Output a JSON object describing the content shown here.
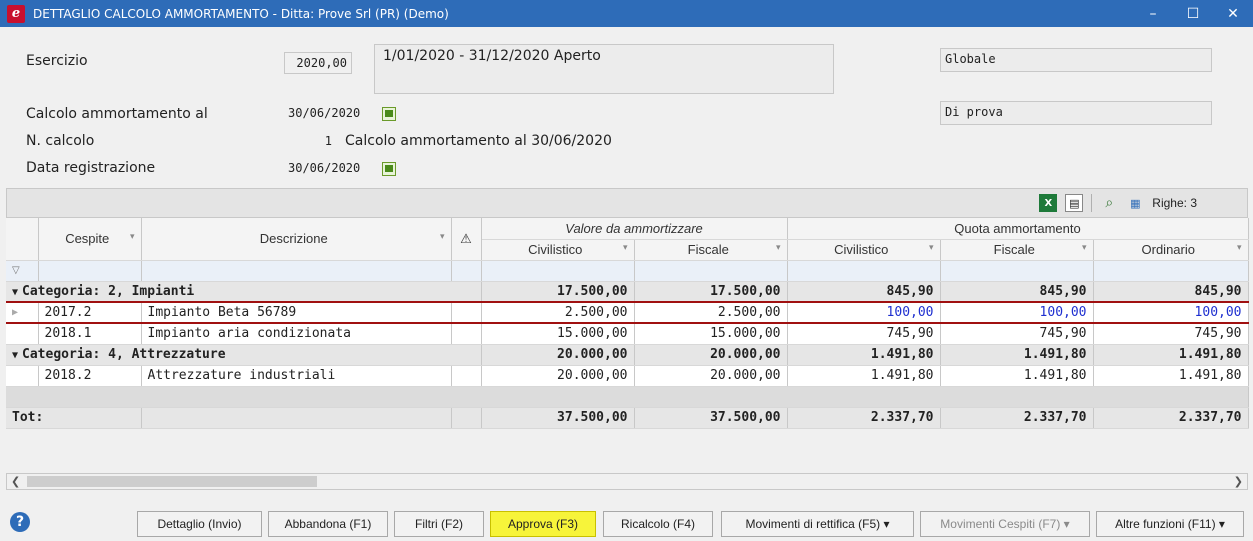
{
  "window": {
    "title": "DETTAGLIO CALCOLO AMMORTAMENTO - Ditta: Prove Srl (PR) (Demo)",
    "minimize": "–",
    "maximize": "☐",
    "close": "✕"
  },
  "header": {
    "esercizio_label": "Esercizio",
    "esercizio_value": "2020,00",
    "periodo_value": "1/01/2020 - 31/12/2020 Aperto",
    "tipo_value": "Globale",
    "calcolo_al_label": "Calcolo ammortamento al",
    "calcolo_al_value": "30/06/2020",
    "modalita_value": "Di prova",
    "n_calcolo_label": "N. calcolo",
    "n_calcolo_value": "1",
    "n_calcolo_desc": "Calcolo ammortamento al 30/06/2020",
    "data_reg_label": "Data registrazione",
    "data_reg_value": "30/06/2020"
  },
  "toolbar": {
    "righe": "Righe: 3"
  },
  "grid": {
    "headers": {
      "cespite": "Cespite",
      "descrizione": "Descrizione",
      "valore_group": "Valore da ammortizzare",
      "quota_group": "Quota ammortamento",
      "civilistico": "Civilistico",
      "fiscale": "Fiscale",
      "ordinario": "Ordinario"
    },
    "cat1": {
      "label": "Categoria: 2, Impianti",
      "val_civ": "17.500,00",
      "val_fis": "17.500,00",
      "q_civ": "845,90",
      "q_fis": "845,90",
      "q_ord": "845,90"
    },
    "rows1": [
      {
        "cespite": "2017.2",
        "descrizione": "Impianto Beta 56789",
        "val_civ": "2.500,00",
        "val_fis": "2.500,00",
        "q_civ": "100,00",
        "q_fis": "100,00",
        "q_ord": "100,00"
      },
      {
        "cespite": "2018.1",
        "descrizione": "Impianto aria condizionata",
        "val_civ": "15.000,00",
        "val_fis": "15.000,00",
        "q_civ": "745,90",
        "q_fis": "745,90",
        "q_ord": "745,90"
      }
    ],
    "cat2": {
      "label": "Categoria: 4, Attrezzature",
      "val_civ": "20.000,00",
      "val_fis": "20.000,00",
      "q_civ": "1.491,80",
      "q_fis": "1.491,80",
      "q_ord": "1.491,80"
    },
    "rows2": [
      {
        "cespite": "2018.2",
        "descrizione": "Attrezzature industriali",
        "val_civ": "20.000,00",
        "val_fis": "20.000,00",
        "q_civ": "1.491,80",
        "q_fis": "1.491,80",
        "q_ord": "1.491,80"
      }
    ],
    "totals": {
      "label": "Tot:",
      "val_civ": "37.500,00",
      "val_fis": "37.500,00",
      "q_civ": "2.337,70",
      "q_fis": "2.337,70",
      "q_ord": "2.337,70"
    }
  },
  "buttons": {
    "dettaglio": "Dettaglio (Invio)",
    "abbandona": "Abbandona (F1)",
    "filtri": "Filtri (F2)",
    "approva": "Approva (F3)",
    "ricalcolo": "Ricalcolo (F4)",
    "movimenti_rettifica": "Movimenti di rettifica (F5) ▾",
    "movimenti_cespiti": "Movimenti Cespiti (F7) ▾",
    "altre_funzioni": "Altre funzioni (F11) ▾"
  },
  "colors": {
    "titlebar": "#2e6cb8",
    "highlight": "#f7f43a",
    "link_blue": "#1e2fd0",
    "accent_red": "#a01010"
  }
}
